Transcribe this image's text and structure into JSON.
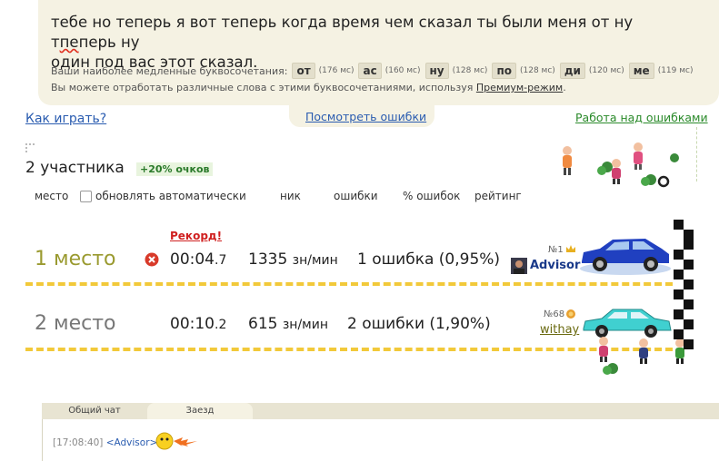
{
  "typed_text": {
    "line1_before": "тебе но теперь я вот теперь когда время чем сказал ты были меня от ну т",
    "line1_error": "пе",
    "line1_after": "перь ну",
    "line2": "один под вас этот сказал."
  },
  "slow_combos": {
    "label": "Ваши наиболее медленные буквосочетания:",
    "items": [
      {
        "combo": "от",
        "ms": "(176 мс)"
      },
      {
        "combo": "ас",
        "ms": "(160 мс)"
      },
      {
        "combo": "ну",
        "ms": "(128 мс)"
      },
      {
        "combo": "по",
        "ms": "(128 мс)"
      },
      {
        "combo": "ди",
        "ms": "(120 мс)"
      },
      {
        "combo": "ме",
        "ms": "(119 мс)"
      }
    ]
  },
  "practice": {
    "text_before": "Вы можете отработать различные слова с этими буквосочетаниями, используя",
    "link": "Премиум-режим",
    "text_after": "."
  },
  "nav": {
    "how_to_play": "Как играть?",
    "view_errors": "Посмотреть ошибки",
    "work_on_errors": "Работа над ошибками"
  },
  "race": {
    "participants": "2 участника",
    "bonus": "+20% очков",
    "columns": {
      "place": "место",
      "auto_update": "обновлять автоматически",
      "nick": "ник",
      "errors": "ошибки",
      "error_pct": "% ошибок",
      "rating": "рейтинг"
    },
    "record": "Рекорд!",
    "results": [
      {
        "place": "1 место",
        "time_main": "00:04",
        "time_frac": ".7",
        "speed": "1335",
        "speed_unit": "зн/мин",
        "errors": "1 ошибка (0,95%)",
        "rank_no": "№1",
        "nick": "Advisor"
      },
      {
        "place": "2 место",
        "time_main": "00:10",
        "time_frac": ".2",
        "speed": "615",
        "speed_unit": "зн/мин",
        "errors": "2 ошибки (1,90%)",
        "rank_no": "№68",
        "nick": "withay"
      }
    ]
  },
  "chat": {
    "tabs": [
      "Общий чат",
      "Заезд"
    ],
    "messages": [
      {
        "time": "[17:08:40]",
        "nick": "<Advisor>"
      }
    ]
  },
  "colors": {
    "panel_bg": "#f5f2e3",
    "link_blue": "#2a5cb0",
    "link_green": "#2a8a2a",
    "record_red": "#d02020",
    "first_place": "#9a9a30",
    "second_place": "#777777",
    "track_dash": "#f2c93a"
  }
}
